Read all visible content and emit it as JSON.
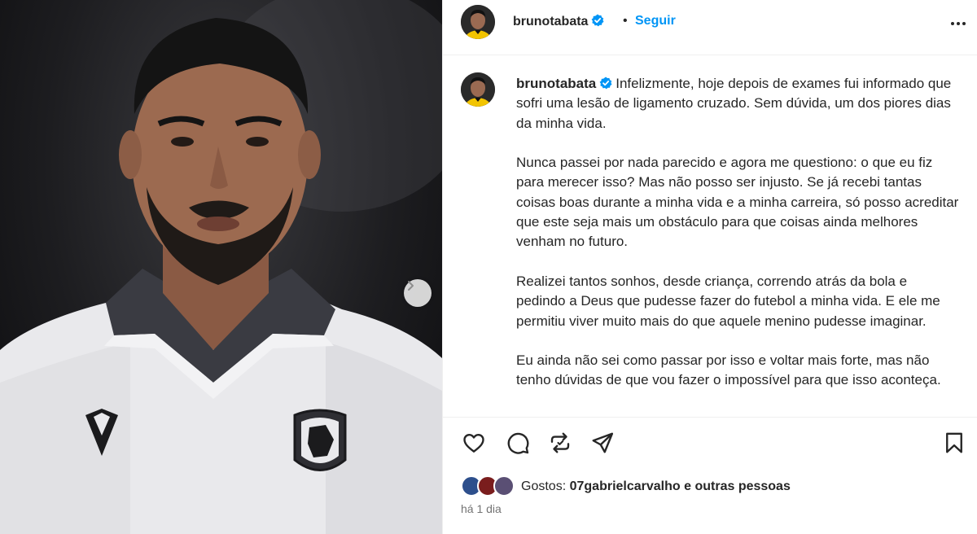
{
  "post": {
    "username": "brunotabata",
    "follow_label": "Seguir",
    "separator": "•",
    "caption": {
      "paragraphs": [
        "Infelizmente, hoje depois de exames fui informado que sofri uma lesão de ligamento cruzado. Sem dúvida, um dos piores dias da minha vida.",
        "Nunca passei por nada parecido e agora me questiono: o que eu fiz para merecer isso? Mas não posso ser injusto. Se já recebi tantas coisas boas durante a minha vida e a minha carreira, só posso acreditar que este seja mais um obstáculo para que coisas ainda melhores venham no futuro.",
        "Realizei tantos sonhos, desde criança, correndo atrás da bola e pedindo a Deus que pudesse fazer do futebol a minha vida. E ele me permitiu viver muito mais do que aquele menino pudesse imaginar.",
        "Eu ainda não sei como passar por isso e voltar mais forte, mas não tenho dúvidas de que vou fazer o impossível para que isso aconteça."
      ]
    },
    "likes": {
      "prefix": "Gostos:",
      "first_user": "07gabrielcarvalho",
      "suffix": "e outras pessoas"
    },
    "timestamp": "há 1 dia"
  },
  "icons": {
    "verified": "verified-badge-icon",
    "more": "more-options-icon",
    "like": "heart-icon",
    "comment": "comment-icon",
    "repost": "repost-icon",
    "share": "share-icon",
    "save": "bookmark-icon",
    "next": "chevron-right-icon"
  },
  "colors": {
    "accent": "#0095f6",
    "text": "#262626",
    "muted": "#737373",
    "divider": "#efefef"
  }
}
